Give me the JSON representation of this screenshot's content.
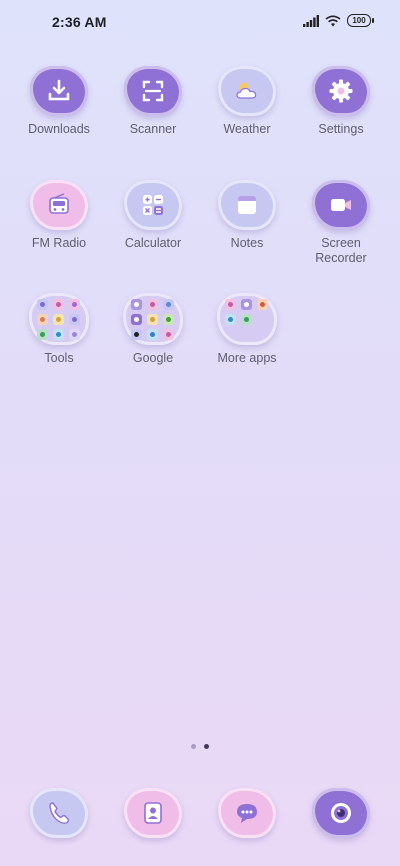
{
  "status": {
    "time": "2:36 AM",
    "battery": "100"
  },
  "apps": [
    {
      "label": "Downloads",
      "name": "downloads"
    },
    {
      "label": "Scanner",
      "name": "scanner"
    },
    {
      "label": "Weather",
      "name": "weather"
    },
    {
      "label": "Settings",
      "name": "settings"
    },
    {
      "label": "FM Radio",
      "name": "fm-radio"
    },
    {
      "label": "Calculator",
      "name": "calculator"
    },
    {
      "label": "Notes",
      "name": "notes"
    },
    {
      "label": "Screen\nRecorder",
      "name": "screen-recorder"
    },
    {
      "label": "Tools",
      "name": "tools"
    },
    {
      "label": "Google",
      "name": "google"
    },
    {
      "label": "More apps",
      "name": "more-apps"
    }
  ],
  "dock": [
    {
      "name": "phone"
    },
    {
      "name": "contacts"
    },
    {
      "name": "messages"
    },
    {
      "name": "camera"
    }
  ],
  "pages": {
    "count": 2,
    "current": 2
  },
  "colors": {
    "accent": "#8f70d4",
    "light": "#c6c8f2",
    "pink": "#f0bde8"
  }
}
